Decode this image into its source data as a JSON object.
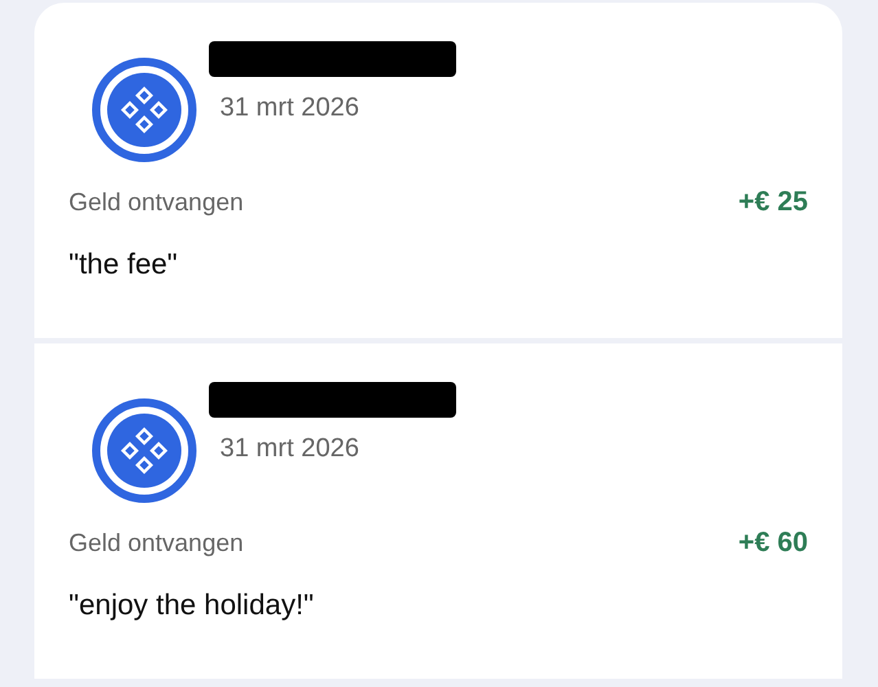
{
  "transactions": [
    {
      "name_redacted": true,
      "date": "31 mrt 2026",
      "label": "Geld ontvangen",
      "amount": "+€ 25",
      "note": "\"the fee\""
    },
    {
      "name_redacted": true,
      "date": "31 mrt 2026",
      "label": "Geld ontvangen",
      "amount": "+€ 60",
      "note": "\"enjoy the holiday!\""
    }
  ]
}
